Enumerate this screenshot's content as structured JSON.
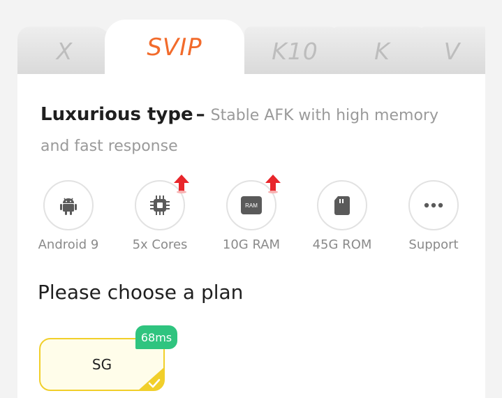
{
  "tabs": [
    {
      "label": "X",
      "active": false
    },
    {
      "label": "SVIP",
      "active": true
    },
    {
      "label": "K10",
      "active": false
    },
    {
      "label": "K",
      "active": false
    },
    {
      "label": "V",
      "active": false
    }
  ],
  "colors": {
    "accent": "#f26b2b",
    "upgrade_arrow": "#e8262b",
    "selected_border": "#f1cf2a",
    "badge": "#2fc47f",
    "icon": "#5a5a5a"
  },
  "description": {
    "title": "Luxurious type",
    "dash": "–",
    "text": "Stable AFK with high memory and fast response"
  },
  "specs": [
    {
      "icon": "android-icon",
      "label": "Android 9",
      "upgraded": false
    },
    {
      "icon": "cpu-icon",
      "label": "5x Cores",
      "upgraded": true
    },
    {
      "icon": "ram-icon",
      "label": "10G RAM",
      "icon_text": "RAM",
      "upgraded": true
    },
    {
      "icon": "sd-card-icon",
      "label": "45G ROM",
      "upgraded": false
    },
    {
      "icon": "more-icon",
      "label": "Support",
      "upgraded": false
    }
  ],
  "plan_section": {
    "heading": "Please choose a plan",
    "plans": [
      {
        "name": "SG",
        "latency": "68ms",
        "selected": true
      }
    ]
  }
}
